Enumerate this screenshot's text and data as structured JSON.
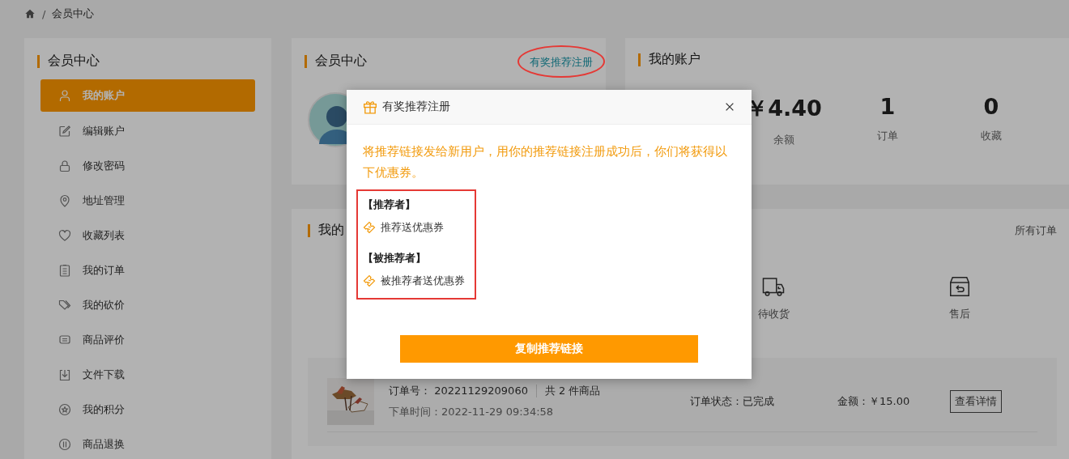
{
  "breadcrumb": {
    "separator": "/",
    "items": [
      "会员中心"
    ]
  },
  "sidebar": {
    "title": "会员中心",
    "items": [
      {
        "label": "我的账户",
        "kind": "user",
        "selected": true
      },
      {
        "label": "编辑账户",
        "kind": "edit",
        "selected": false
      },
      {
        "label": "修改密码",
        "kind": "lock",
        "selected": false
      },
      {
        "label": "地址管理",
        "kind": "pin",
        "selected": false
      },
      {
        "label": "收藏列表",
        "kind": "heart",
        "selected": false
      },
      {
        "label": "我的订单",
        "kind": "list",
        "selected": false
      },
      {
        "label": "我的砍价",
        "kind": "tag",
        "selected": false
      },
      {
        "label": "商品评价",
        "kind": "comment",
        "selected": false
      },
      {
        "label": "文件下载",
        "kind": "download",
        "selected": false
      },
      {
        "label": "我的积分",
        "kind": "star",
        "selected": false
      },
      {
        "label": "商品退换",
        "kind": "exchange",
        "selected": false
      }
    ]
  },
  "member_card": {
    "title": "会员中心",
    "link": "有奖推荐注册"
  },
  "account_card": {
    "title": "我的账户",
    "stats": [
      {
        "value": "￥4.40",
        "label": "余额"
      },
      {
        "value": "1",
        "label": "订单"
      },
      {
        "value": "0",
        "label": "收藏"
      }
    ]
  },
  "orders_card": {
    "title": "我的",
    "all_link": "所有订单",
    "statuses": [
      {
        "label": "待收货",
        "kind": "truck"
      },
      {
        "label": "售后",
        "kind": "return"
      }
    ],
    "order": {
      "number_label": "订单号：",
      "number": "20221129209060",
      "count": "共 2 件商品",
      "time": "下单时间：2022-11-29 09:34:58",
      "status": "订单状态：已完成",
      "amount": "金额：￥15.00",
      "button": "查看详情"
    }
  },
  "modal": {
    "title": "有奖推荐注册",
    "message": "将推荐链接发给新用户，用你的推荐链接注册成功后，你们将获得以下优惠券。",
    "groups": [
      {
        "heading": "【推荐者】",
        "coupon": "推荐送优惠券"
      },
      {
        "heading": "【被推荐者】",
        "coupon": "被推荐者送优惠券"
      }
    ],
    "button": "复制推荐链接"
  }
}
